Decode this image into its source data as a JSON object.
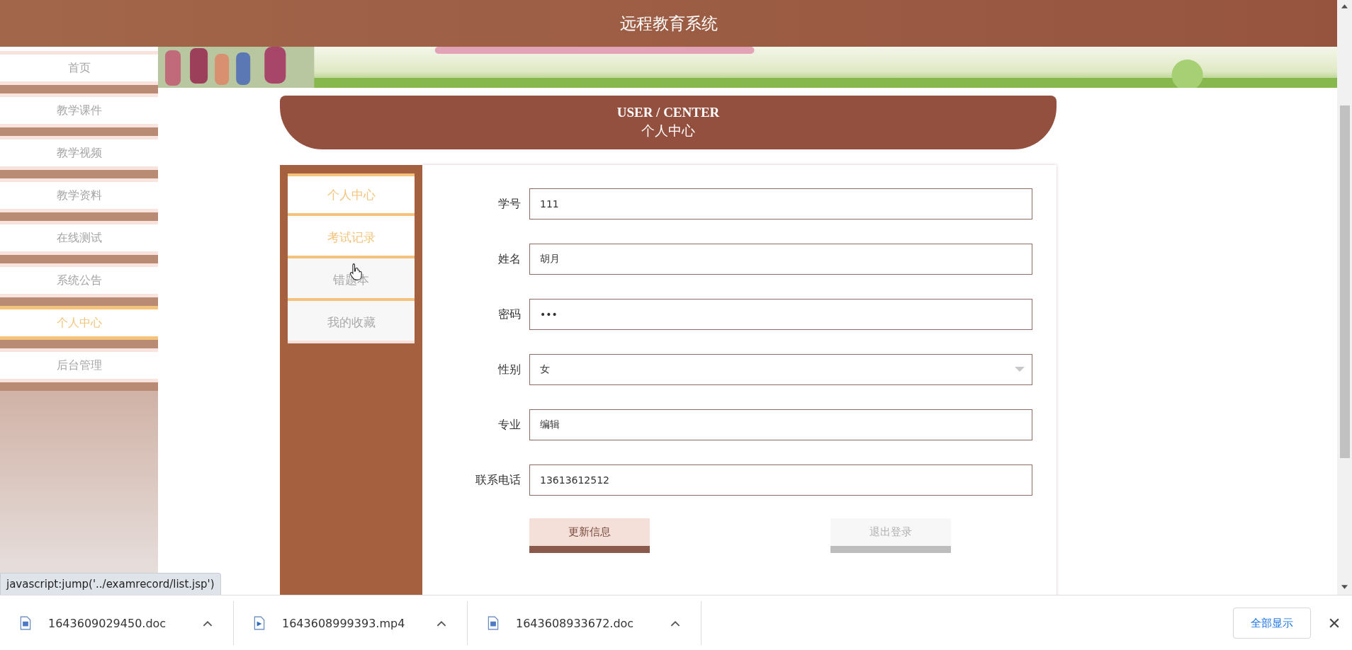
{
  "header": {
    "title": "远程教育系统"
  },
  "sidebar": {
    "items": [
      {
        "label": "首页",
        "selected": false
      },
      {
        "label": "教学课件",
        "selected": false
      },
      {
        "label": "教学视频",
        "selected": false
      },
      {
        "label": "教学资料",
        "selected": false
      },
      {
        "label": "在线测试",
        "selected": false
      },
      {
        "label": "系统公告",
        "selected": false
      },
      {
        "label": "个人中心",
        "selected": true
      },
      {
        "label": "后台管理",
        "selected": false
      }
    ]
  },
  "section_heading": {
    "title": "USER / CENTER",
    "subtitle": "个人中心"
  },
  "side_menu": {
    "items": [
      {
        "label": "个人中心",
        "selected": true
      },
      {
        "label": "考试记录",
        "selected": true
      },
      {
        "label": "错题本",
        "selected": false
      },
      {
        "label": "我的收藏",
        "selected": false
      }
    ]
  },
  "form": {
    "fields": [
      {
        "label": "学号",
        "kind": "text",
        "value": "111"
      },
      {
        "label": "姓名",
        "kind": "text",
        "value": "胡月"
      },
      {
        "label": "密码",
        "kind": "text",
        "value": "•••"
      },
      {
        "label": "性别",
        "kind": "select",
        "value": "女"
      },
      {
        "label": "专业",
        "kind": "text",
        "value": "编辑"
      },
      {
        "label": "联系电话",
        "kind": "text",
        "value": "13613612512"
      }
    ],
    "buttons": [
      {
        "label": "更新信息",
        "kind": "primary"
      },
      {
        "label": "退出登录",
        "kind": "secondary"
      }
    ]
  },
  "status_url": "javascript:jump('../examrecord/list.jsp')",
  "downloads": {
    "items": [
      {
        "name": "1643609029450.doc",
        "kind": "doc"
      },
      {
        "name": "1643608999393.mp4",
        "kind": "video"
      },
      {
        "name": "1643608933672.doc",
        "kind": "doc"
      }
    ],
    "show_all": "全部显示"
  }
}
